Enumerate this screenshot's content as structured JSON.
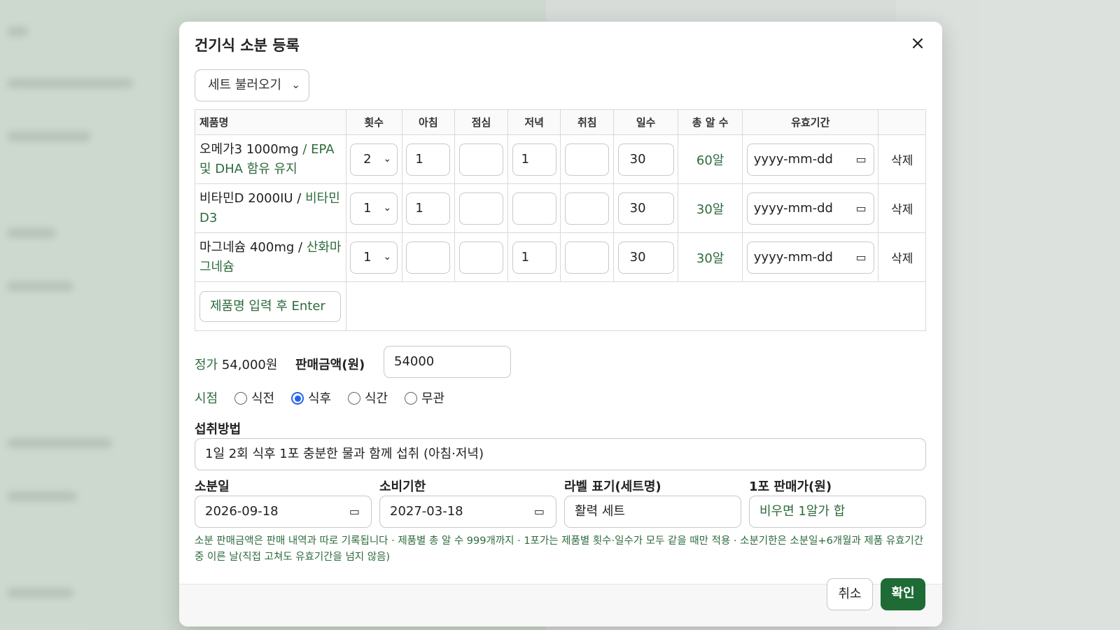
{
  "modal": {
    "title": "건기식 소분 등록",
    "close_icon": "×",
    "set_select": "세트 불러오기"
  },
  "table": {
    "headers": [
      "제품명",
      "횟수",
      "아침",
      "점심",
      "저녁",
      "취침",
      "일수",
      "총 알 수",
      "유효기간",
      ""
    ],
    "rows": [
      {
        "name": "오메가3 1000mg",
        "ingredient": "/ EPA 및 DHA 함유 유지",
        "count": "2",
        "morning": "1",
        "lunch": "",
        "evening": "1",
        "bedtime": "",
        "days": "30",
        "total": "60알",
        "expiry": "yyyy-mm-dd",
        "delete": "삭제"
      },
      {
        "name": "비타민D 2000IU /",
        "ingredient": "비타민D3",
        "count": "1",
        "morning": "1",
        "lunch": "",
        "evening": "",
        "bedtime": "",
        "days": "30",
        "total": "30알",
        "expiry": "yyyy-mm-dd",
        "delete": "삭제"
      },
      {
        "name": "마그네슘 400mg /",
        "ingredient": "산화마그네슘",
        "count": "1",
        "morning": "",
        "lunch": "",
        "evening": "1",
        "bedtime": "",
        "days": "30",
        "total": "30알",
        "expiry": "yyyy-mm-dd",
        "delete": "삭제"
      }
    ],
    "new_product_placeholder": "제품명 입력 후 Enter"
  },
  "pricing": {
    "list_price_label": "정가",
    "list_price": "54,000원",
    "sale_label": "판매금액(원)",
    "sale_value": "54000"
  },
  "timing": {
    "label": "시점",
    "options": [
      "식전",
      "식후",
      "식간",
      "무관"
    ],
    "selected": "식후"
  },
  "intake": {
    "label": "섭취방법",
    "value": "1일 2회 식후 1포 충분한 물과 함께 섭취 (아침·저녁)"
  },
  "fields": {
    "dispense_date_label": "소분일",
    "dispense_date": "2026-09-18",
    "expiry_label": "소비기한",
    "expiry": "2027-03-18",
    "set_name_label": "라벨 표기(세트명)",
    "set_name": "활력 세트",
    "pack_price_label": "1포 판매가(원)",
    "pack_price_placeholder": "비우면 1알가 합"
  },
  "note": "소분 판매금액은 판매 내역과 따로 기록됩니다 · 제품별 총 알 수 999개까지 · 1포가는 제품별 횟수·일수가 모두 같을 때만 적용 · 소분기한은 소분일+6개월과 제품 유효기간 중 이른 날(직접 고쳐도 유효기간을 넘지 않음)",
  "footer": {
    "cancel": "취소",
    "confirm": "확인"
  },
  "colors": {
    "accent_green": "#2e6b3c",
    "confirm_button": "#1e6b35",
    "radio_selected": "#2563eb"
  }
}
